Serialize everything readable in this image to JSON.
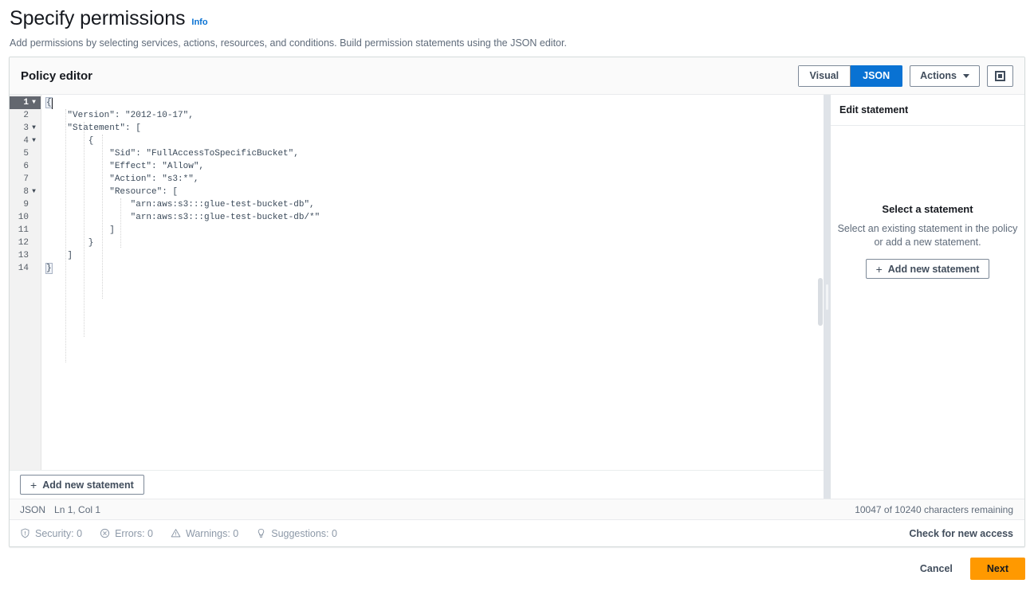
{
  "page": {
    "title": "Specify permissions",
    "info_label": "Info",
    "description": "Add permissions by selecting services, actions, resources, and conditions. Build permission statements using the JSON editor."
  },
  "policy_editor": {
    "title": "Policy editor",
    "view_toggle": {
      "options": [
        "Visual",
        "JSON"
      ],
      "selected": "JSON"
    },
    "actions_button": "Actions",
    "caret_icon": "chevron-down-icon",
    "maximize_icon": "maximize-icon",
    "add_statement_button": "Add new statement",
    "plus_icon": "plus-icon"
  },
  "code": {
    "language_label": "JSON",
    "cursor_position": "Ln 1, Col 1",
    "characters_remaining": "10047 of 10240 characters remaining",
    "active_line": 1,
    "lines": [
      {
        "n": 1,
        "fold": true,
        "text": "{"
      },
      {
        "n": 2,
        "fold": false,
        "text": "    \"Version\": \"2012-10-17\","
      },
      {
        "n": 3,
        "fold": true,
        "text": "    \"Statement\": ["
      },
      {
        "n": 4,
        "fold": true,
        "text": "        {"
      },
      {
        "n": 5,
        "fold": false,
        "text": "            \"Sid\": \"FullAccessToSpecificBucket\","
      },
      {
        "n": 6,
        "fold": false,
        "text": "            \"Effect\": \"Allow\","
      },
      {
        "n": 7,
        "fold": false,
        "text": "            \"Action\": \"s3:*\","
      },
      {
        "n": 8,
        "fold": true,
        "text": "            \"Resource\": ["
      },
      {
        "n": 9,
        "fold": false,
        "text": "                \"arn:aws:s3:::glue-test-bucket-db\","
      },
      {
        "n": 10,
        "fold": false,
        "text": "                \"arn:aws:s3:::glue-test-bucket-db/*\""
      },
      {
        "n": 11,
        "fold": false,
        "text": "            ]"
      },
      {
        "n": 12,
        "fold": false,
        "text": "        }"
      },
      {
        "n": 13,
        "fold": false,
        "text": "    ]"
      },
      {
        "n": 14,
        "fold": false,
        "text": "}"
      }
    ]
  },
  "edit_panel": {
    "header": "Edit statement",
    "empty_title": "Select a statement",
    "empty_description": "Select an existing statement in the policy or add a new statement.",
    "add_statement_button": "Add new statement",
    "plus_icon": "plus-icon"
  },
  "diagnostics": {
    "items": [
      {
        "icon": "shield-alert-icon",
        "label": "Security: 0"
      },
      {
        "icon": "error-circle-icon",
        "label": "Errors: 0"
      },
      {
        "icon": "warning-triangle-icon",
        "label": "Warnings: 0"
      },
      {
        "icon": "lightbulb-icon",
        "label": "Suggestions: 0"
      }
    ],
    "check_access_link": "Check for new access"
  },
  "footer": {
    "cancel": "Cancel",
    "next": "Next"
  },
  "colors": {
    "accent_blue": "#0972d3",
    "primary_orange": "#ff9900",
    "text_dark": "#16191f",
    "text_muted": "#5f6b7a"
  }
}
